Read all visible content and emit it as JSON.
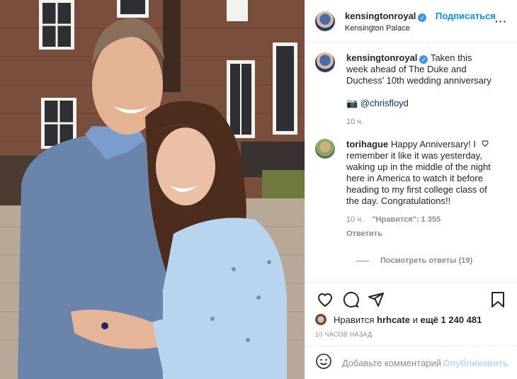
{
  "post": {
    "image_alt": "Photo of the Duke and Duchess of Cambridge"
  },
  "header": {
    "username": "kensingtonroyal",
    "follow_label": "Подписаться",
    "location": "Kensington Palace",
    "separator": "•"
  },
  "caption": {
    "username": "kensingtonroyal",
    "text": "Taken this week ahead of The Duke and Duchess’ 10th wedding anniversary",
    "credit_icon": "camera-emoji",
    "credit_emoji": "📷",
    "credit_link": "@chrisfloyd",
    "time": "10 ч."
  },
  "comment": {
    "username": "torihague",
    "text": "Happy Anniversary! I remember it like it was yesterday, waking up in the middle of the night here in America to watch it before heading to my first college class of the day. Congratulations!!",
    "time": "10 ч.",
    "likes": "\"Нравится\": 1 355",
    "reply_label": "Ответить",
    "view_replies": "Посмотреть ответы (19)"
  },
  "likes": {
    "prefix": "Нравится",
    "user": "hrhcate",
    "connector": "и",
    "others": "ещё 1 240 481"
  },
  "time_ago": "10 часов назад",
  "add_comment": {
    "placeholder": "Добавьте комментарий...",
    "publish_label": "Опубликовать"
  },
  "colors": {
    "accent": "#0095f6",
    "verified": "#3897f0",
    "publish_disabled": "#b2dffc",
    "muted": "#8e8e8e"
  },
  "icons": [
    "heart-icon",
    "comment-icon",
    "share-icon",
    "bookmark-icon",
    "more-icon",
    "emoji-icon",
    "verified-icon",
    "comment-like-icon"
  ]
}
